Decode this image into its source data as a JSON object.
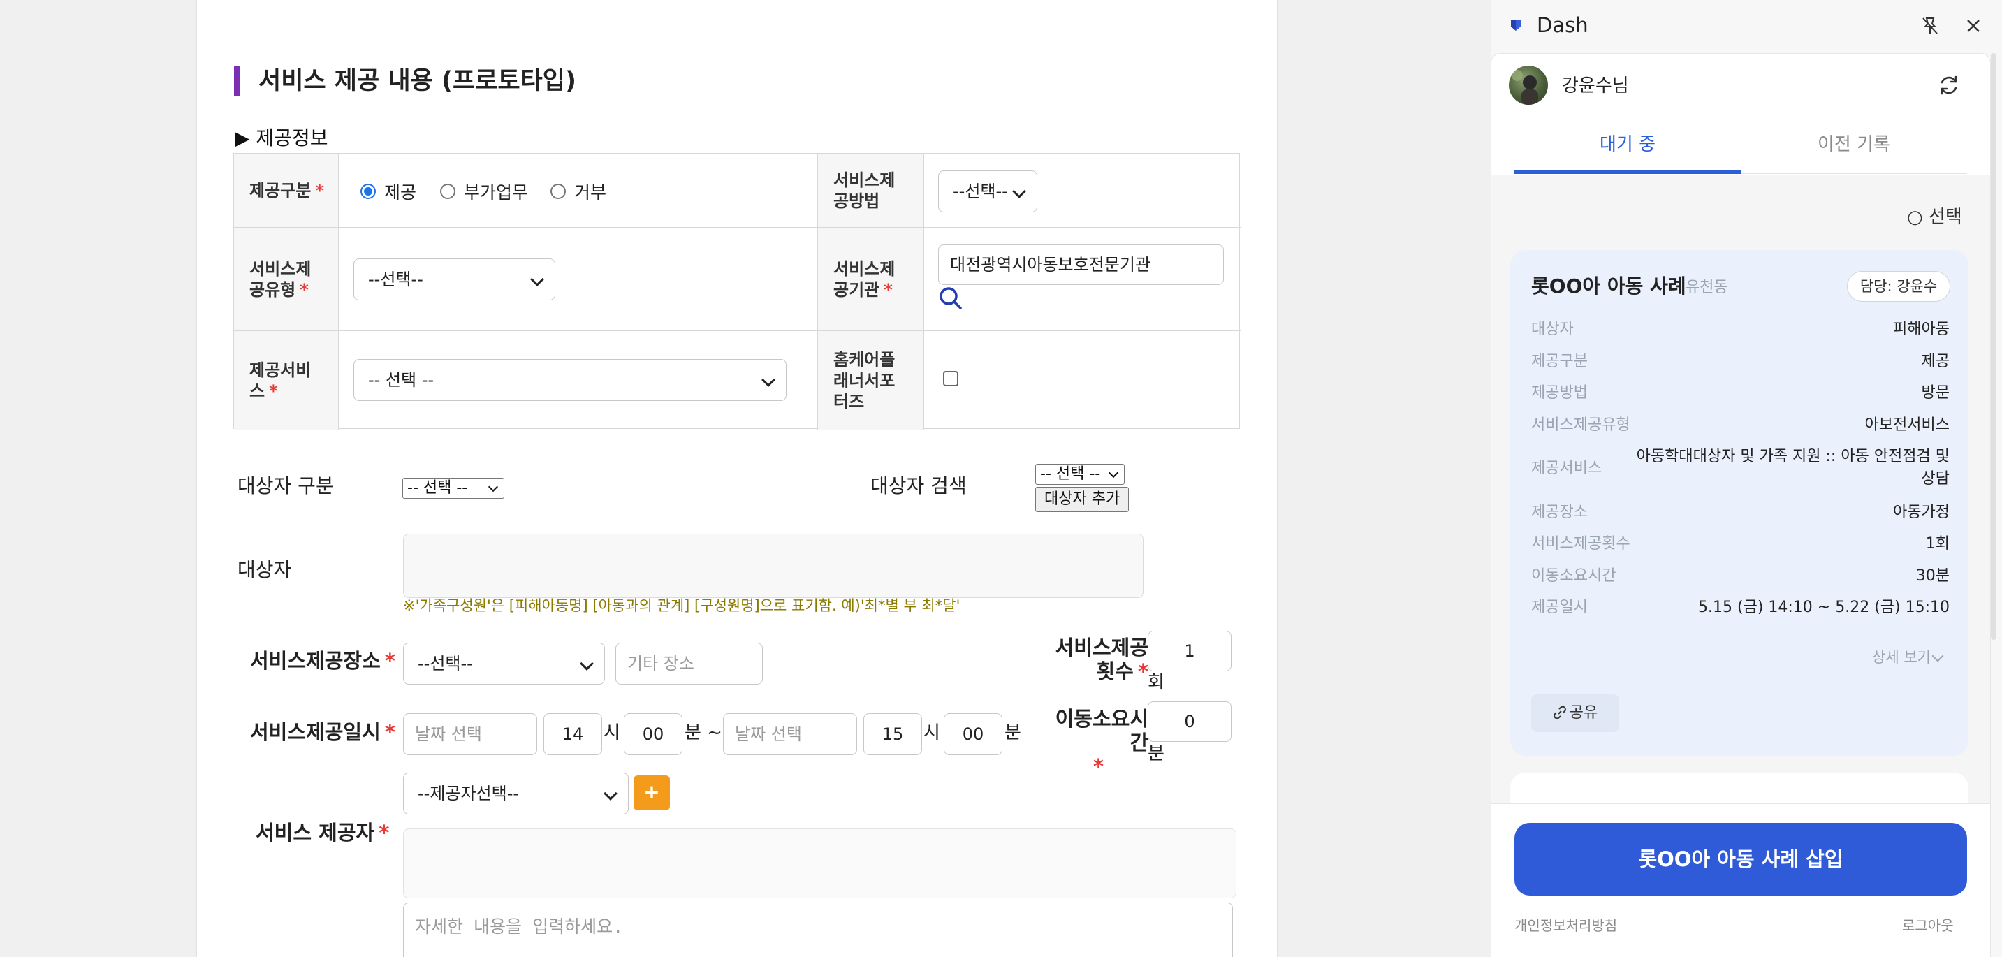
{
  "form": {
    "title": "서비스 제공 내용 (프로토타입)",
    "section_label": "▶ 제공정보",
    "provide_type": {
      "label": "제공구분",
      "options": [
        "제공",
        "부가업무",
        "거부"
      ],
      "selected": "제공"
    },
    "provide_method": {
      "label": "서비스제공방법",
      "value": "--선택--"
    },
    "service_type": {
      "label": "서비스제공유형",
      "value": "--선택--"
    },
    "provider_org": {
      "label": "서비스제공기관",
      "value": "대전광역시아동보호전문기관"
    },
    "service": {
      "label": "제공서비스",
      "value": "-- 선택 --"
    },
    "homecare": {
      "label": "홈케어플래너서포터즈"
    },
    "target_type": {
      "label": "대상자 구분",
      "value": "-- 선택 --"
    },
    "target_search": {
      "label": "대상자 검색",
      "value": "-- 선택 --",
      "add_button": "대상자 추가"
    },
    "target": {
      "label": "대상자",
      "notice": "※'가족구성원'은 [피해아동명] [아동과의 관계] [구성원명]으로 표기함. 예)'최*별 부 최*달'"
    },
    "place": {
      "label": "서비스제공장소",
      "value": "--선택--",
      "etc_placeholder": "기타 장소"
    },
    "count": {
      "label": "서비스제공횟수",
      "value": "1",
      "unit": "회"
    },
    "datetime": {
      "label": "서비스제공일시",
      "start_date_placeholder": "날짜 선택",
      "start_hour": "14",
      "start_min": "00",
      "end_date_placeholder": "날짜 선택",
      "end_hour": "15",
      "end_min": "00",
      "hour_unit": "시",
      "min_unit": "분",
      "range_sep": "분 ~"
    },
    "travel": {
      "label": "이동소요시간",
      "value": "0",
      "unit": "분"
    },
    "provider": {
      "label": "서비스 제공자",
      "value": "--제공자선택--",
      "add_label": "+"
    },
    "detail_placeholder": "자세한 내용을 입력하세요."
  },
  "panel": {
    "app_name": "Dash",
    "user_name": "강윤수님",
    "tabs": [
      "대기 중",
      "이전 기록"
    ],
    "select_label": "○ 선택",
    "case": {
      "title": "롯OO아 아동 사례",
      "sub": "유천동",
      "owner": "담당: 강윤수",
      "rows": [
        {
          "k": "대상자",
          "v": "피해아동"
        },
        {
          "k": "제공구분",
          "v": "제공"
        },
        {
          "k": "제공방법",
          "v": "방문"
        },
        {
          "k": "서비스제공유형",
          "v": "아보전서비스"
        },
        {
          "k": "제공서비스",
          "v": "아동학대대상자 및 가족 지원 :: 아동 안전점검 및",
          "v2": "상담"
        },
        {
          "k": "제공장소",
          "v": "아동가정"
        },
        {
          "k": "서비스제공횟수",
          "v": "1회"
        },
        {
          "k": "이동소요시간",
          "v": "30분"
        },
        {
          "k": "제공일시",
          "v": "5.15 (금) 14:10 ~ 5.22 (금) 15:10"
        }
      ],
      "detail_link": "상세 보기",
      "share": "공유"
    },
    "next_case_title": "롯OO아 아동 사례",
    "insert_button": "롯OO아 아동 사례 삽입",
    "privacy": "개인정보처리방침",
    "logout": "로그아웃"
  }
}
